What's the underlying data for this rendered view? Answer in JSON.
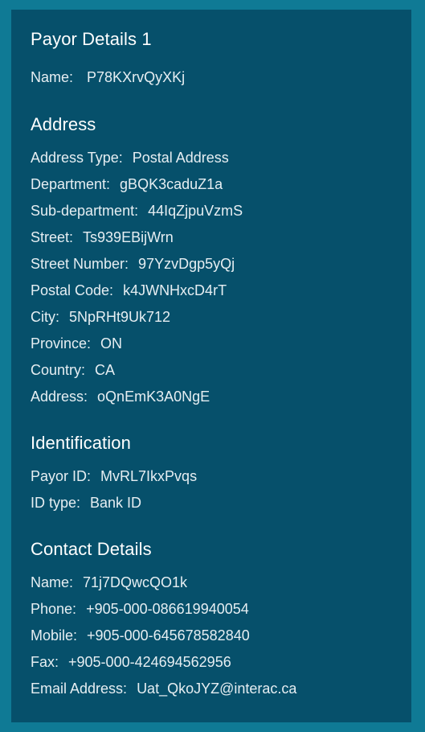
{
  "payor": {
    "title": "Payor Details 1",
    "name_label": "Name:",
    "name_value": "P78KXrvQyXKj"
  },
  "address": {
    "title": "Address",
    "rows": [
      {
        "label": "Address Type:",
        "value": "Postal Address"
      },
      {
        "label": "Department:",
        "value": "gBQK3caduZ1a"
      },
      {
        "label": "Sub-department:",
        "value": "44IqZjpuVzmS"
      },
      {
        "label": "Street:",
        "value": "Ts939EBijWrn"
      },
      {
        "label": "Street Number:",
        "value": "97YzvDgp5yQj"
      },
      {
        "label": "Postal Code:",
        "value": "k4JWNHxcD4rT"
      },
      {
        "label": "City:",
        "value": "5NpRHt9Uk712"
      },
      {
        "label": "Province:",
        "value": "ON"
      },
      {
        "label": "Country:",
        "value": "CA"
      },
      {
        "label": "Address:",
        "value": "oQnEmK3A0NgE"
      }
    ]
  },
  "identification": {
    "title": "Identification",
    "rows": [
      {
        "label": "Payor ID:",
        "value": "MvRL7IkxPvqs"
      },
      {
        "label": "ID type:",
        "value": "Bank ID"
      }
    ]
  },
  "contact": {
    "title": "Contact Details",
    "rows": [
      {
        "label": "Name:",
        "value": "71j7DQwcQO1k"
      },
      {
        "label": "Phone:",
        "value": "+905-000-086619940054"
      },
      {
        "label": "Mobile:",
        "value": "+905-000-645678582840"
      },
      {
        "label": "Fax:",
        "value": "+905-000-424694562956"
      },
      {
        "label": "Email Address:",
        "value": "Uat_QkoJYZ@interac.ca"
      }
    ]
  },
  "colors": {
    "frame": "#0f7a95",
    "panel": "#06506b",
    "text": "#ffffff"
  }
}
